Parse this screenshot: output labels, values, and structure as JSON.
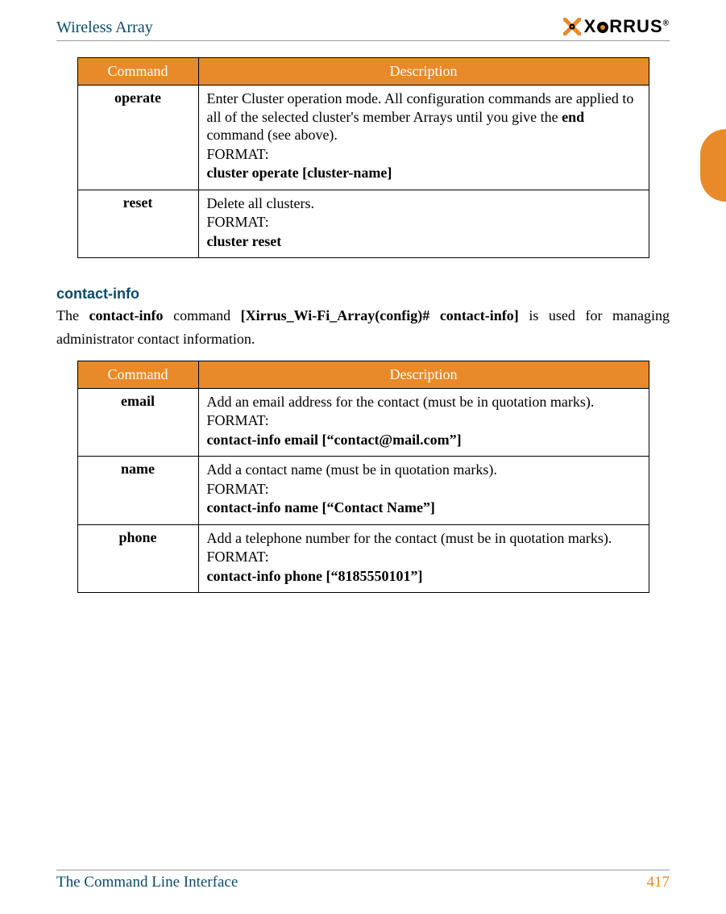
{
  "header": {
    "title": "Wireless Array",
    "brand_prefix": "X",
    "brand_suffix": "RRUS"
  },
  "tables": {
    "col_cmd": "Command",
    "col_desc": "Description",
    "cluster": [
      {
        "cmd": "operate",
        "desc_line1a": "Enter Cluster operation mode. All configuration commands are applied to all of the selected cluster's member Arrays until you give the ",
        "desc_line1b": "end",
        "desc_line1c": " command (see above).",
        "format_label": "FORMAT:",
        "format_value": "cluster operate [cluster-name]"
      },
      {
        "cmd": "reset",
        "desc_line1a": "Delete all clusters.",
        "desc_line1b": "",
        "desc_line1c": "",
        "format_label": "FORMAT:",
        "format_value": "cluster reset"
      }
    ],
    "contact": [
      {
        "cmd": "email",
        "desc": "Add an email address for the contact (must be in quotation marks).",
        "format_label": "FORMAT:",
        "format_value": "contact-info email [“contact@mail.com”]"
      },
      {
        "cmd": "name",
        "desc": "Add a contact name (must be in quotation marks).",
        "format_label": "FORMAT:",
        "format_value": "contact-info name [“Contact Name”]"
      },
      {
        "cmd": "phone",
        "desc": "Add a telephone number for the contact (must be in quotation marks).",
        "format_label": "FORMAT:",
        "format_value": "contact-info phone [“8185550101”]"
      }
    ]
  },
  "section": {
    "heading": "contact-info",
    "intro_a": "The ",
    "intro_b": "contact-info",
    "intro_c": " command ",
    "intro_d": "[Xirrus_Wi-Fi_Array(config)# contact-info]",
    "intro_e": " is used for managing administrator contact information."
  },
  "footer": {
    "title": "The Command Line Interface",
    "page": "417"
  }
}
